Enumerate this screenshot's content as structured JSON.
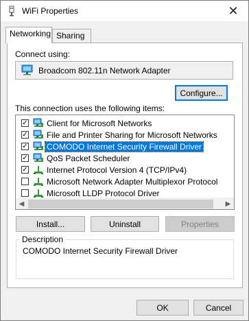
{
  "window": {
    "title": "WiFi Properties"
  },
  "tabs": [
    {
      "label": "Networking",
      "active": true
    },
    {
      "label": "Sharing",
      "active": false
    }
  ],
  "connect": {
    "label": "Connect using:",
    "adapter": "Broadcom 802.11n Network Adapter",
    "configure_button": "Configure..."
  },
  "items": {
    "label": "This connection uses the following items:",
    "list": [
      {
        "text": "Client for Microsoft Networks",
        "checked": true,
        "icon": "network-client-icon",
        "selected": false
      },
      {
        "text": "File and Printer Sharing for Microsoft Networks",
        "checked": true,
        "icon": "network-client-icon",
        "selected": false
      },
      {
        "text": "COMODO Internet Security Firewall Driver",
        "checked": true,
        "icon": "network-client-icon",
        "selected": true
      },
      {
        "text": "QoS Packet Scheduler",
        "checked": true,
        "icon": "network-client-icon",
        "selected": false
      },
      {
        "text": "Internet Protocol Version 4 (TCP/IPv4)",
        "checked": true,
        "icon": "protocol-icon",
        "selected": false
      },
      {
        "text": "Microsoft Network Adapter Multiplexor Protocol",
        "checked": false,
        "icon": "protocol-icon",
        "selected": false
      },
      {
        "text": "Microsoft LLDP Protocol Driver",
        "checked": false,
        "icon": "protocol-icon",
        "selected": false
      }
    ]
  },
  "buttons": {
    "install": "Install...",
    "uninstall": "Uninstall",
    "properties": "Properties"
  },
  "description": {
    "label": "Description",
    "text": "COMODO Internet Security Firewall Driver"
  },
  "footer": {
    "ok": "OK",
    "cancel": "Cancel"
  },
  "colors": {
    "selection": "#0078d7",
    "focus_border": "#0078d7"
  }
}
